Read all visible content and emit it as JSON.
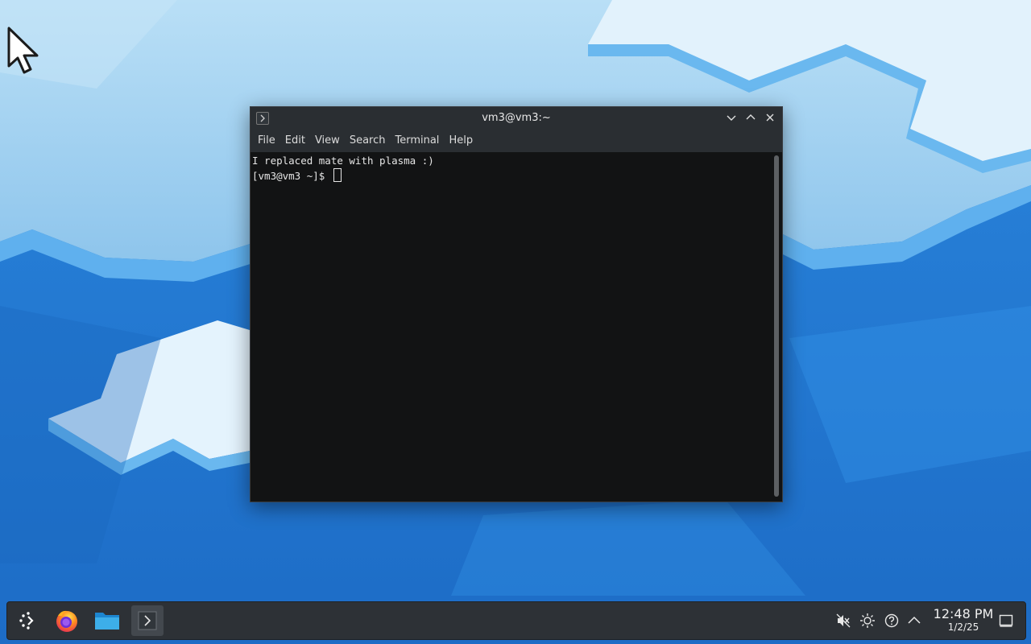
{
  "window": {
    "title": "vm3@vm3:~",
    "menu": [
      "File",
      "Edit",
      "View",
      "Search",
      "Terminal",
      "Help"
    ]
  },
  "terminal": {
    "lines": [
      "I replaced mate with plasma :)",
      "[vm3@vm3 ~]$ "
    ]
  },
  "taskbar": {
    "launchers": [
      {
        "name": "application-launcher-icon"
      },
      {
        "name": "firefox-icon"
      },
      {
        "name": "file-manager-icon"
      },
      {
        "name": "terminal-icon"
      }
    ],
    "tray": [
      "volume-muted-icon",
      "brightness-icon",
      "help-icon",
      "show-hidden-icon"
    ],
    "clock": {
      "time": "12:48 PM",
      "date": "1/2/25"
    }
  },
  "colors": {
    "terminal_bg": "#121314",
    "titlebar_bg": "#2a2e32",
    "taskbar_bg": "#2d3136",
    "accent": "#3daee9"
  }
}
